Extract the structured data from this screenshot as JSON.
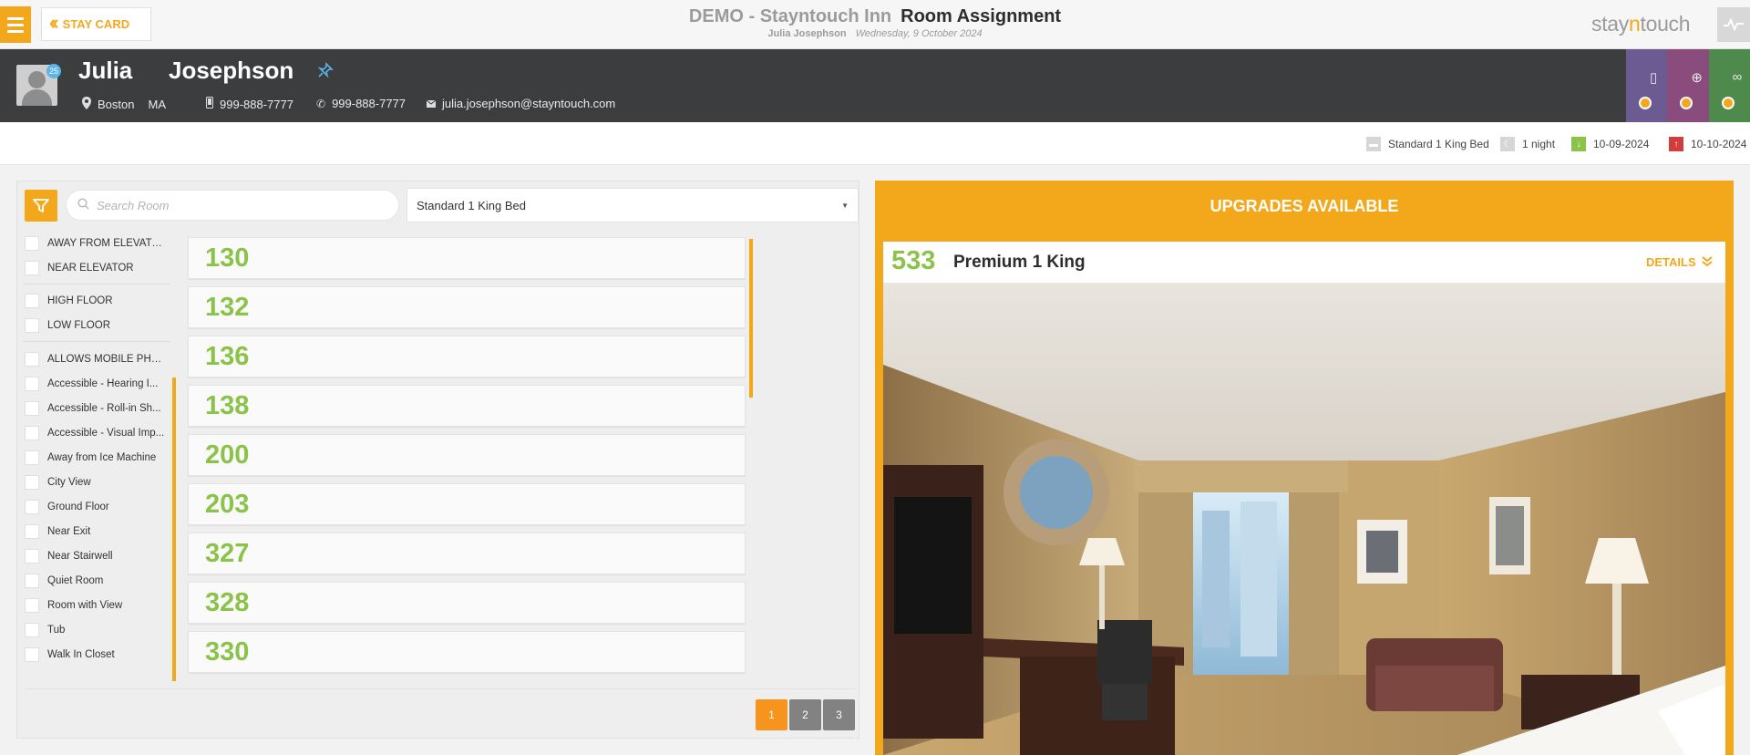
{
  "header": {
    "stay_card_label": "STAY CARD",
    "hotel_name": "DEMO - Stayntouch Inn",
    "page_title": "Room Assignment",
    "guest_name": "Julia Josephson",
    "date": "Wednesday, 9 October 2024",
    "logo_prefix": "stay",
    "logo_highlight": "n",
    "logo_suffix": "touch"
  },
  "guest": {
    "first_name": "Julia",
    "last_name": "Josephson",
    "badge": "25",
    "city": "Boston",
    "state": "MA",
    "mobile": "999-888-7777",
    "phone": "999-888-7777",
    "email": "julia.josephson@stayntouch.com"
  },
  "summary": {
    "room_type": "Standard 1 King Bed",
    "nights": "1 night",
    "arrival": "10-09-2024",
    "departure": "10-10-2024"
  },
  "search": {
    "placeholder": "Search Room",
    "selected_room_type": "Standard 1 King Bed"
  },
  "filters": [
    "AWAY FROM ELEVATOR",
    "NEAR ELEVATOR",
    "HIGH FLOOR",
    "LOW FLOOR",
    "ALLOWS MOBILE PHO...",
    "Accessible - Hearing I...",
    "Accessible - Roll-in Sh...",
    "Accessible - Visual Imp...",
    "Away from Ice Machine",
    "City View",
    "Ground Floor",
    "Near Exit",
    "Near Stairwell",
    "Quiet Room",
    "Room with View",
    "Tub",
    "Walk In Closet"
  ],
  "rooms": [
    "130",
    "132",
    "136",
    "138",
    "200",
    "203",
    "327",
    "328",
    "330"
  ],
  "pagination": {
    "pages": [
      "1",
      "2",
      "3"
    ],
    "current": "1"
  },
  "upgrades": {
    "title": "UPGRADES AVAILABLE",
    "room_number": "533",
    "room_name": "Premium 1 King",
    "details_label": "DETAILS"
  },
  "colors": {
    "accent": "#f3a81c",
    "room_number": "#8bc34a",
    "guest_bar": "#3c3d3f"
  },
  "icons": [
    "menu-icon",
    "double-chevron-left-icon",
    "pulse-icon",
    "pin-icon",
    "location-icon",
    "mobile-icon",
    "phone-icon",
    "email-icon",
    "bed-icon",
    "moon-icon",
    "arrival-icon",
    "departure-icon",
    "filter-icon",
    "search-icon",
    "caret-down-icon",
    "double-chevron-down-icon"
  ]
}
